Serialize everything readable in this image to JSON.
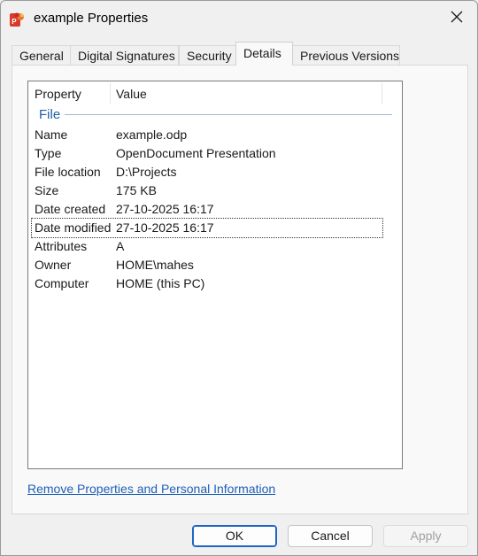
{
  "window": {
    "title": "example Properties"
  },
  "icons": {
    "app": "impress-presentation-icon",
    "close": "close-icon"
  },
  "tabs": [
    {
      "label": "General"
    },
    {
      "label": "Digital Signatures"
    },
    {
      "label": "Security"
    },
    {
      "label": "Details",
      "active": true
    },
    {
      "label": "Previous Versions"
    }
  ],
  "details": {
    "columns": {
      "property": "Property",
      "value": "Value"
    },
    "group": "File",
    "rows": [
      {
        "property": "Name",
        "value": "example.odp"
      },
      {
        "property": "Type",
        "value": "OpenDocument Presentation"
      },
      {
        "property": "File location",
        "value": "D:\\Projects"
      },
      {
        "property": "Size",
        "value": "175 KB"
      },
      {
        "property": "Date created",
        "value": "27-10-2025 16:17"
      },
      {
        "property": "Date modified",
        "value": "27-10-2025 16:17",
        "selected": true
      },
      {
        "property": "Attributes",
        "value": "A"
      },
      {
        "property": "Owner",
        "value": "HOME\\mahes"
      },
      {
        "property": "Computer",
        "value": "HOME (this PC)"
      }
    ]
  },
  "link": {
    "label": "Remove Properties and Personal Information"
  },
  "buttons": {
    "ok": "OK",
    "cancel": "Cancel",
    "apply": "Apply"
  },
  "colors": {
    "accent": "#1f66c4",
    "link": "#1f5fb8",
    "group": "#1e5ea8"
  }
}
